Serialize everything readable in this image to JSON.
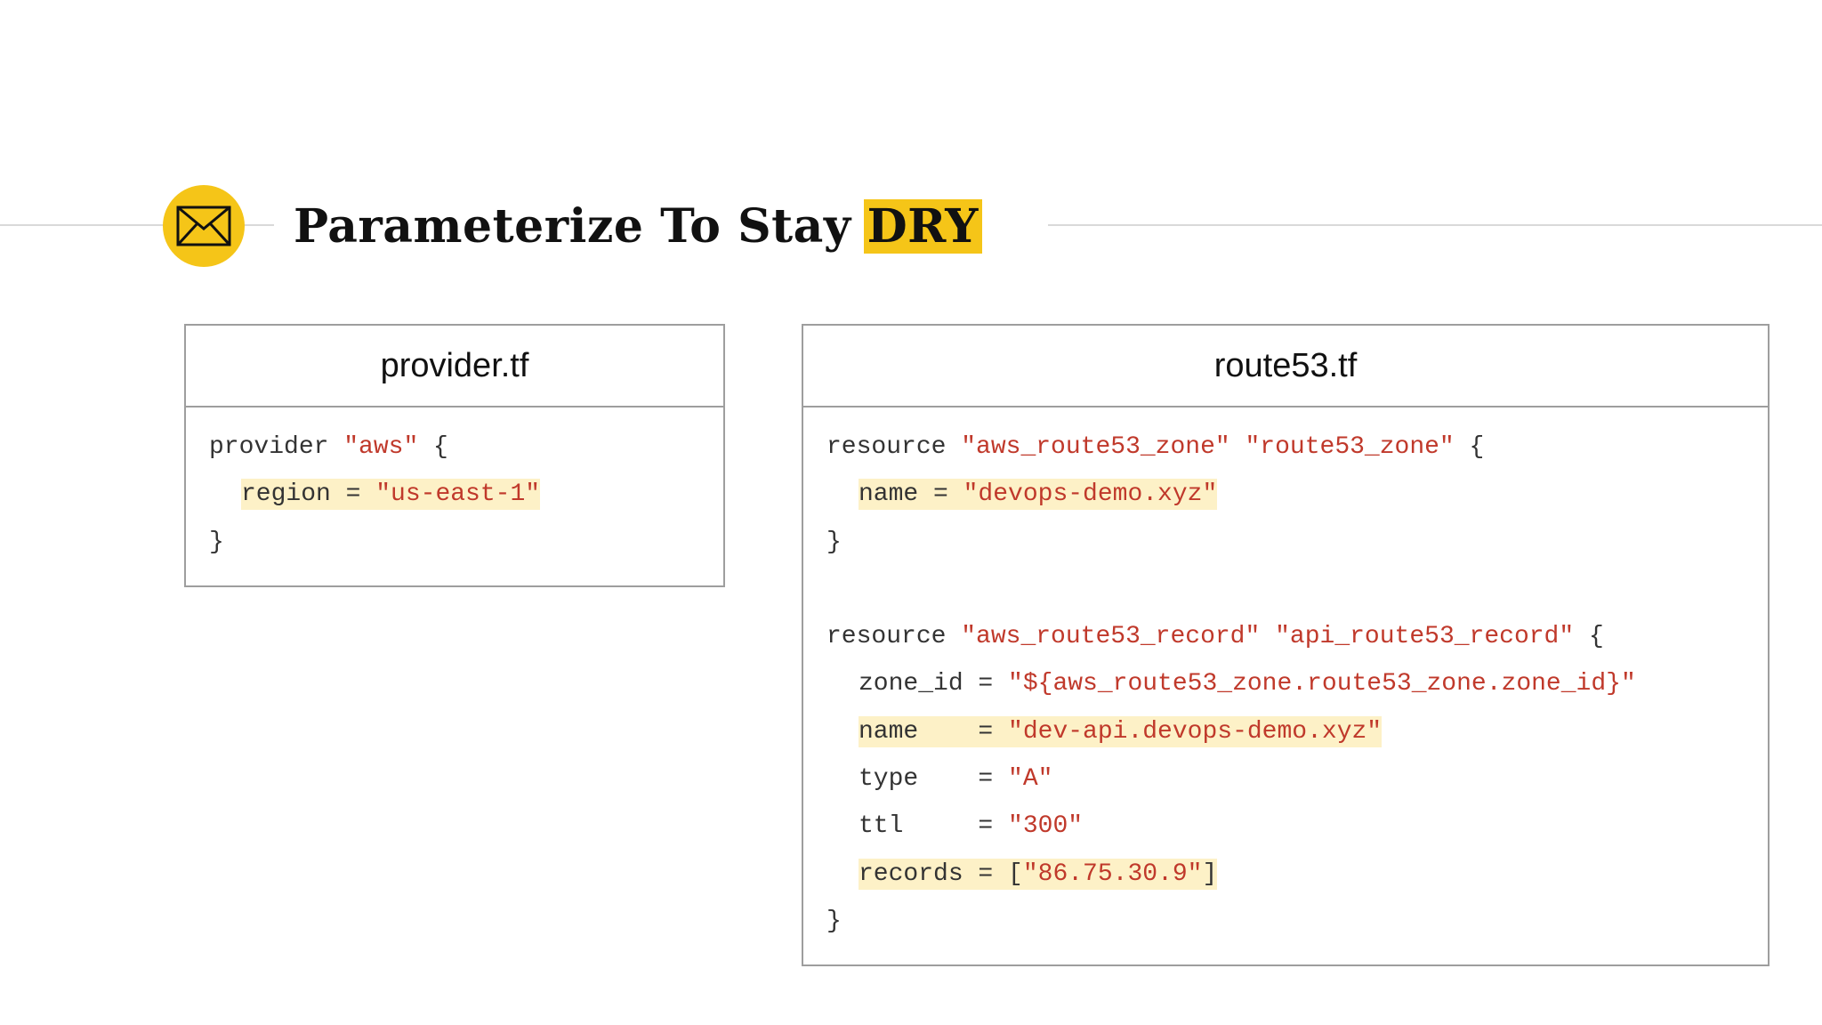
{
  "slide": {
    "title_main": "Parameterize To Stay",
    "title_highlight": "DRY",
    "icon": "envelope-icon",
    "accent_color": "#f5c518",
    "highlight_color": "#fdf1c7",
    "string_color": "#c0392b"
  },
  "provider_panel": {
    "filename": "provider.tf",
    "lines": [
      {
        "kw": "provider ",
        "s1": "\"aws\"",
        "end": " {"
      },
      {
        "key": "region = ",
        "val": "\"us-east-1\""
      },
      {
        "close": "}"
      }
    ]
  },
  "route53_panel": {
    "filename": "route53.tf",
    "zone_block": {
      "kw": "resource ",
      "type": "\"aws_route53_zone\"",
      "name": "\"route53_zone\"",
      "open": " {",
      "name_key": "name = ",
      "name_val": "\"devops-demo.xyz\"",
      "close": "}"
    },
    "record_block": {
      "kw": "resource ",
      "type": "\"aws_route53_record\"",
      "name": "\"api_route53_record\"",
      "open": " {",
      "zone_id_key": "zone_id = ",
      "zone_id_val": "\"${aws_route53_zone.route53_zone.zone_id}\"",
      "name_key": "name    = ",
      "name_val": "\"dev-api.devops-demo.xyz\"",
      "type_key": "type    = ",
      "type_val": "\"A\"",
      "ttl_key": "ttl     = ",
      "ttl_val": "\"300\"",
      "records_key": "records = ",
      "records_open": "[",
      "records_val": "\"86.75.30.9\"",
      "records_close": "]",
      "close": "}"
    }
  }
}
